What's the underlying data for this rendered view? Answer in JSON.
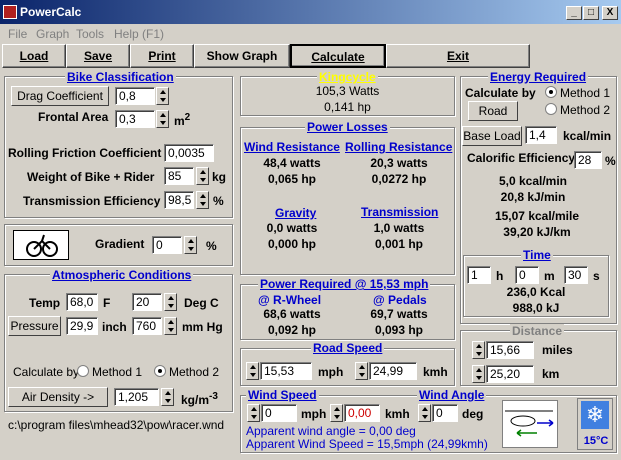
{
  "window": {
    "title": "PowerCalc",
    "min": "_",
    "max": "□",
    "close": "X"
  },
  "menu": [
    "File",
    "Graph",
    "Tools",
    "Help (F1)"
  ],
  "toolbar": [
    "Load",
    "Save",
    "Print",
    "Show Graph",
    "Calculate",
    "Exit"
  ],
  "bike": {
    "title": "Bike Classification",
    "drag_btn": "Drag Coefficient",
    "drag": "0,8",
    "area_lbl": "Frontal Area",
    "area": "0,3",
    "area_unit": "m",
    "area_exp": "2",
    "rf_lbl": "Rolling Friction Coefficient",
    "rf": "0,0035",
    "weight_lbl": "Weight of Bike + Rider",
    "weight": "85",
    "weight_unit": "kg",
    "trans_lbl": "Transmission Efficiency",
    "trans": "98,5",
    "trans_unit": "%"
  },
  "gradient": {
    "lbl": "Gradient",
    "val": "0",
    "unit": "%"
  },
  "atmo": {
    "title": "Atmospheric Conditions",
    "temp_lbl": "Temp",
    "temp_f": "68,0",
    "f": "F",
    "temp_c": "20",
    "degc": "Deg C",
    "pressure_btn": "Pressure",
    "p_inch": "29,9",
    "inch": "inch",
    "p_mm": "760",
    "mmhg": "mm Hg",
    "calc_by": "Calculate by",
    "m1": "Method 1",
    "m2": "Method 2",
    "air_btn": "Air Density ->",
    "air": "1,205",
    "air_unit": "kg/m",
    "air_exp": "-3"
  },
  "path": "c:\\program files\\mhead32\\pow\\racer.wnd",
  "kingcycle": {
    "title": "Kingcycle",
    "watts": "105,3 Watts",
    "hp": "0,141 hp"
  },
  "losses": {
    "title": "Power Losses",
    "wind_t": "Wind Resistance",
    "wind_w": "48,4 watts",
    "wind_hp": "0,065 hp",
    "roll_t": "Rolling Resistance",
    "roll_w": "20,3 watts",
    "roll_hp": "0,0272 hp",
    "grav_t": "Gravity",
    "grav_w": "0,0 watts",
    "grav_hp": "0,000 hp",
    "tr_t": "Transmission",
    "tr_w": "1,0 watts",
    "tr_hp": "0,001 hp"
  },
  "required": {
    "title": "Power Required @  15,53 mph",
    "rw_t": "@ R-Wheel",
    "rw_w": "68,6 watts",
    "rw_hp": "0,092 hp",
    "pd_t": "@ Pedals",
    "pd_w": "69,7 watts",
    "pd_hp": "0,093 hp"
  },
  "road": {
    "title": "Road Speed",
    "mph": "15,53",
    "mph_u": "mph",
    "kmh": "24,99",
    "kmh_u": "kmh"
  },
  "wind": {
    "title": "Wind Speed",
    "mph": "0",
    "mph_u": "mph",
    "kmh": "0,00",
    "kmh_u": "kmh",
    "angle_title": "Wind Angle",
    "angle": "0",
    "deg": "deg",
    "apparent_angle": "Apparent wind angle = 0,00 deg",
    "apparent_speed": "Apparent Wind Speed = 15,5mph (24,99kmh)"
  },
  "energy": {
    "title": "Energy Required",
    "calc_by": "Calculate by",
    "m1": "Method 1",
    "m2": "Method 2",
    "road_btn": "Road",
    "base_btn": "Base Load",
    "base": "1,4",
    "base_unit": "kcal/min",
    "cal_lbl": "Calorific Efficiency",
    "cal": "28",
    "cal_unit": "%",
    "r1": "5,0 kcal/min",
    "r2": "20,8 kJ/min",
    "r3": "15,07 kcal/mile",
    "r4": "39,20 kJ/km"
  },
  "time": {
    "title": "Time",
    "h": "1",
    "h_u": "h",
    "m": "0",
    "m_u": "m",
    "s": "30",
    "s_u": "s",
    "kcal": "236,0 Kcal",
    "kj": "988,0 kJ"
  },
  "distance": {
    "title": "Distance",
    "miles": "15,66",
    "miles_u": "miles",
    "km": "25,20",
    "km_u": "km"
  },
  "temp_badge": "15°C"
}
